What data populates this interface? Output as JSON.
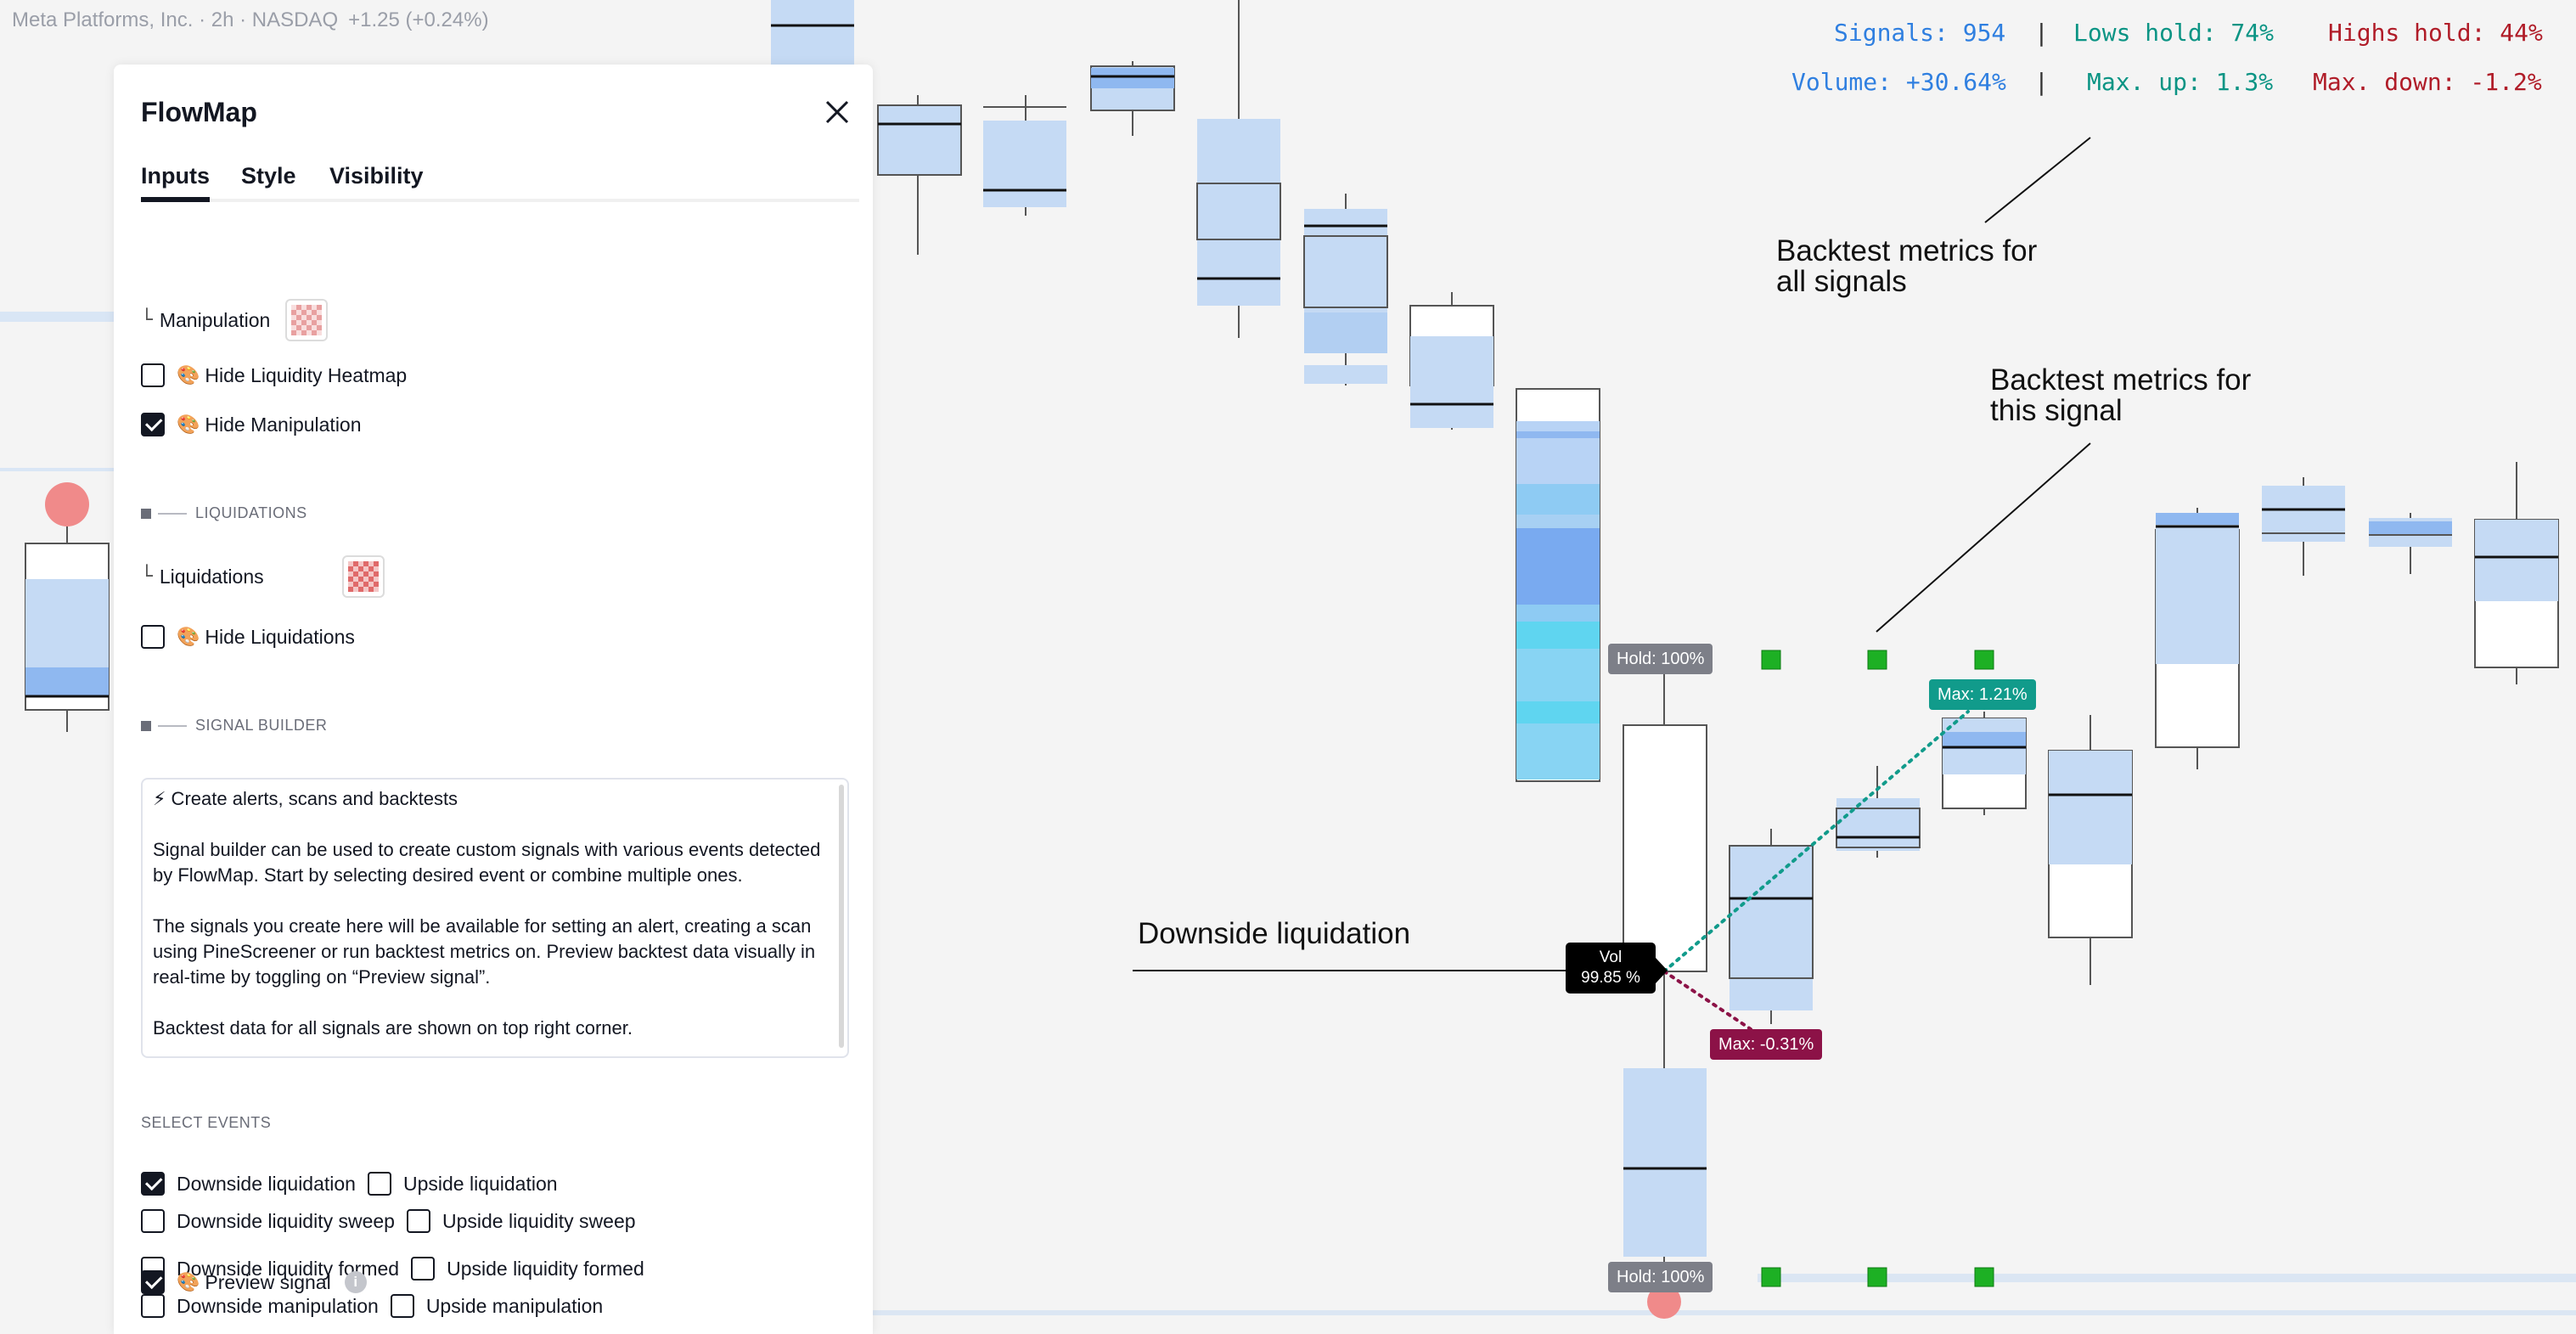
{
  "symbol": {
    "name": "Meta Platforms, Inc. · 2h · NASDAQ",
    "change": "+1.25 (+0.24%)"
  },
  "metrics": {
    "signals": "Signals: 954",
    "lows_hold": "Lows hold: 74%",
    "highs_hold": "Highs hold: 44%",
    "volume": "Volume: +30.64%",
    "max_up": "Max. up: 1.3%",
    "max_down": "Max. down: -1.2%",
    "separator": "|"
  },
  "annotations": {
    "all_signals": "Backtest metrics for\nall signals",
    "this_signal": "Backtest metrics for\nthis signal",
    "downside": "Downside liquidation"
  },
  "chips": {
    "hold_top": "Hold: 100%",
    "hold_bottom": "Hold: 100%",
    "max_up": "Max: 1.21%",
    "max_down": "Max: -0.31%",
    "vol_label": "Vol",
    "vol_value": "99.85 %"
  },
  "panel": {
    "title": "FlowMap",
    "tabs": [
      "Inputs",
      "Style",
      "Visibility"
    ],
    "manipulation_label": "Manipulation",
    "hide_liquidity_heatmap": {
      "label": "Hide Liquidity Heatmap",
      "checked": false
    },
    "hide_manipulation": {
      "label": "Hide Manipulation",
      "checked": true
    },
    "liquidations_section": "LIQUIDATIONS",
    "liquidations_label": "Liquidations",
    "hide_liquidations": {
      "label": "Hide Liquidations",
      "checked": false
    },
    "signal_builder_section": "SIGNAL BUILDER",
    "textarea": {
      "line1": "⚡ Create alerts, scans and backtests",
      "para1": "Signal builder can be used to create custom signals with various events detected by FlowMap. Start by selecting desired event or combine multiple ones.",
      "para2": "The signals you create here will be available for setting an alert, creating a scan using PineScreener or run backtest metrics on. Preview backtest data visually in real-time by toggling on “Preview signal”.",
      "para3": "Backtest data for all signals are shown on top right corner."
    },
    "select_events_title": "SELECT EVENTS",
    "events": {
      "downside_liquidation": {
        "label": "Downside liquidation",
        "checked": true
      },
      "upside_liquidation": {
        "label": "Upside liquidation",
        "checked": false
      },
      "downside_liquidity_sweep": {
        "label": "Downside liquidity sweep",
        "checked": false
      },
      "upside_liquidity_sweep": {
        "label": "Upside liquidity sweep",
        "checked": false
      },
      "downside_liquidity_formed": {
        "label": "Downside liquidity formed",
        "checked": false
      },
      "upside_liquidity_formed": {
        "label": "Upside liquidity formed",
        "checked": false
      },
      "downside_manipulation": {
        "label": "Downside manipulation",
        "checked": false
      },
      "upside_manipulation": {
        "label": "Upside manipulation",
        "checked": false
      }
    },
    "preview_signal": {
      "label": "Preview signal",
      "checked": true
    },
    "info_glyph": "i"
  },
  "icons": {
    "close": "close-icon",
    "emoji": "palette-icon",
    "info": "info-icon"
  },
  "colors": {
    "metric_blue": "#2f7fe0",
    "metric_teal": "#0b9484",
    "metric_red": "#b01c28",
    "candle_fill": "#c5daf4",
    "candle_strong": "#8fb8f0",
    "liquidation_cyan": "#5fd5f0",
    "signal_green": "#1db024",
    "bubble_red": "#f08a8a"
  }
}
